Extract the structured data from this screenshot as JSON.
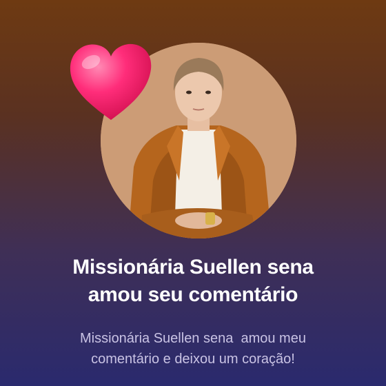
{
  "notification": {
    "title_line1": "Missionária Suellen sena",
    "title_line2": "amou seu comentário",
    "message_line1": "Missionária Suellen sena  amou meu",
    "message_line2": "comentário e deixou um coração!"
  },
  "colors": {
    "heart": "#ff2d7a",
    "title": "#ffffff",
    "message": "#c9c3e4"
  },
  "icons": {
    "reaction": "heart-icon"
  }
}
